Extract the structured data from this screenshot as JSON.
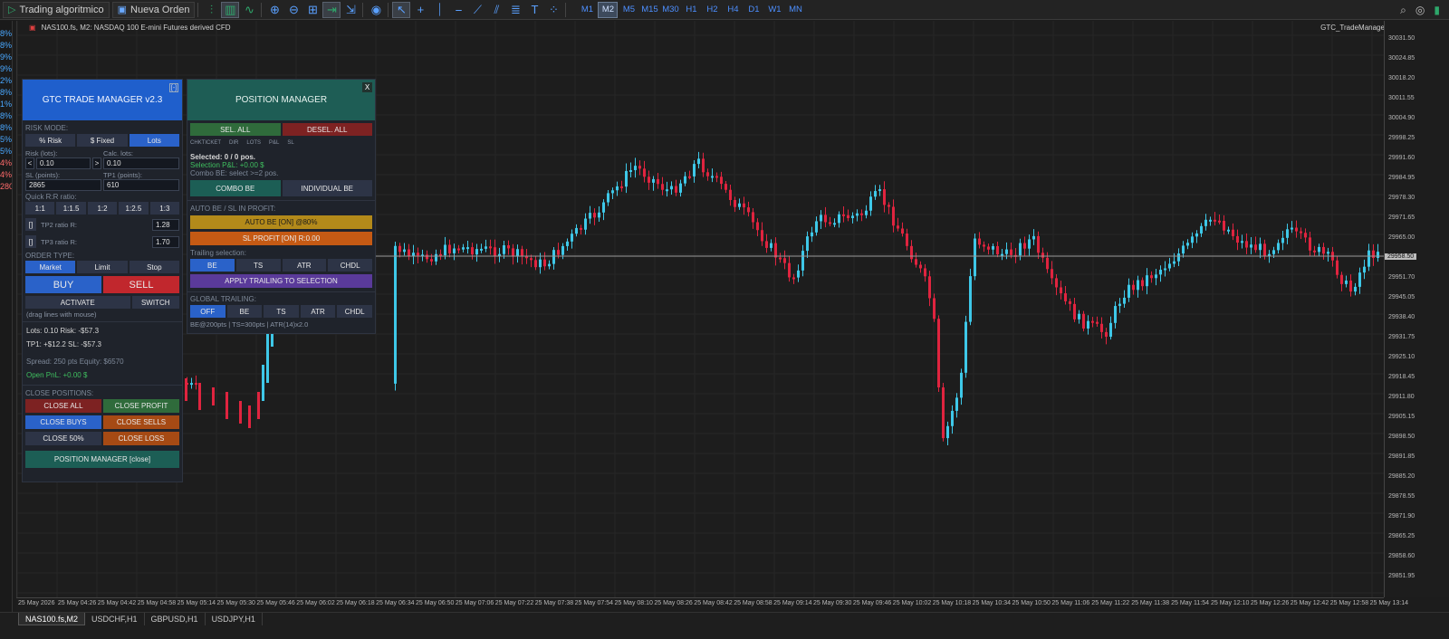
{
  "toolbar": {
    "algo_label": "Trading algoritmico",
    "new_order_label": "Nueva Orden",
    "timeframes": [
      "M1",
      "M2",
      "M5",
      "M15",
      "M30",
      "H1",
      "H2",
      "H4",
      "D1",
      "W1",
      "MN"
    ],
    "active_timeframe": "M2"
  },
  "left_strip": [
    "8%",
    "8%",
    "9%",
    "9%",
    "2%",
    "8%",
    "1%",
    "8%",
    "8%",
    "5%",
    "5%",
    "4%",
    "4%",
    "280"
  ],
  "chart": {
    "title": "NAS100.fs, M2:  NASDAQ 100 E-mini Futures derived CFD",
    "ea_name": "GTC_TradeManager",
    "current_price": "29958.50",
    "price_labels": [
      "30031.50",
      "30024.85",
      "30018.20",
      "30011.55",
      "30004.90",
      "29998.25",
      "29991.60",
      "29984.95",
      "29978.30",
      "29971.65",
      "29965.00",
      "29958.35",
      "29951.70",
      "29945.05",
      "29938.40",
      "29931.75",
      "29925.10",
      "29918.45",
      "29911.80",
      "29905.15",
      "29898.50",
      "29891.85",
      "29885.20",
      "29878.55",
      "29871.90",
      "29865.25",
      "29858.60",
      "29851.95"
    ],
    "time_labels": [
      "25 May 2026",
      "25 May 04:26",
      "25 May 04:42",
      "25 May 04:58",
      "25 May 05:14",
      "25 May 05:30",
      "25 May 05:46",
      "25 May 06:02",
      "25 May 06:18",
      "25 May 06:34",
      "25 May 06:50",
      "25 May 07:06",
      "25 May 07:22",
      "25 May 07:38",
      "25 May 07:54",
      "25 May 08:10",
      "25 May 08:26",
      "25 May 08:42",
      "25 May 08:58",
      "25 May 09:14",
      "25 May 09:30",
      "25 May 09:46",
      "25 May 10:02",
      "25 May 10:18",
      "25 May 10:34",
      "25 May 10:50",
      "25 May 11:06",
      "25 May 11:22",
      "25 May 11:38",
      "25 May 11:54",
      "25 May 12:10",
      "25 May 12:26",
      "25 May 12:42",
      "25 May 12:58",
      "25 May 13:14"
    ],
    "colors": {
      "bull": "#3ec8e8",
      "bear": "#e0243f",
      "bg": "#1d1d1d",
      "grid": "#2a2a2a"
    }
  },
  "tabs": [
    "NAS100.fs,M2",
    "USDCHF,H1",
    "GBPUSD,H1",
    "USDJPY,H1"
  ],
  "trade_manager": {
    "title": "GTC TRADE MANAGER v2.3",
    "min": "[-]",
    "risk_mode": "RISK MODE:",
    "risk_opts": [
      "% Risk",
      "$ Fixed",
      "Lots"
    ],
    "risk_lots_label": "Risk (lots):",
    "calc_lots_label": "Calc. lots:",
    "risk_lots": "0.10",
    "calc_lots": "0.10",
    "sl_label": "SL (points):",
    "tp1_label": "TP1 (points):",
    "sl": "2865",
    "tp1": "610",
    "quick_rr": "Quick R:R ratio:",
    "rr": [
      "1:1",
      "1:1.5",
      "1:2",
      "1:2.5",
      "1:3"
    ],
    "tp2_label": "TP2 ratio R:",
    "tp2": "1.28",
    "tp3_label": "TP3 ratio R:",
    "tp3": "1.70",
    "chk": "[]",
    "order_type": "ORDER TYPE:",
    "order_opts": [
      "Market",
      "Limit",
      "Stop"
    ],
    "buy": "BUY",
    "sell": "SELL",
    "activate": "ACTIVATE",
    "switch": "SWITCH",
    "drag_hint": "(drag lines with mouse)",
    "lots_line": "Lots: 0.10    Risk: -$57.3",
    "tp_line": "TP1: +$12.2    SL: -$57.3",
    "spread_line": "Spread: 250 pts    Equity: $6570",
    "pnl_line": "Open PnL: +0.00 $",
    "close_positions": "CLOSE POSITIONS:",
    "close_all": "CLOSE ALL",
    "close_profit": "CLOSE PROFIT",
    "close_buys": "CLOSE BUYS",
    "close_sells": "CLOSE SELLS",
    "close_50": "CLOSE 50%",
    "close_loss": "CLOSE LOSS",
    "pm_btn": "POSITION MANAGER  [close]"
  },
  "position_manager": {
    "title": "POSITION MANAGER",
    "x": "X",
    "sel_all": "SEL. ALL",
    "desel_all": "DESEL. ALL",
    "headers": [
      "CHK",
      "TICKET",
      "DIR",
      "LOTS",
      "P&L",
      "SL"
    ],
    "selected": "Selected: 0 / 0 pos.",
    "sel_pnl": "Selection P&L: +0.00 $",
    "combo_hint": "Combo BE: select >=2 pos.",
    "combo_be": "COMBO BE",
    "individual_be": "INDIVIDUAL BE",
    "auto_label": "AUTO BE / SL IN PROFIT:",
    "auto_be": "AUTO BE  [ON]  @80%",
    "sl_profit": "SL PROFIT  [ON]  R:0.00",
    "trailing_sel": "Trailing selection:",
    "trail_opts": [
      "BE",
      "TS",
      "ATR",
      "CHDL"
    ],
    "apply": "APPLY TRAILING TO SELECTION",
    "global_trailing": "GLOBAL TRAILING:",
    "global_opts": [
      "OFF",
      "BE",
      "TS",
      "ATR",
      "CHDL"
    ],
    "footer": "BE@200pts | TS=300pts | ATR(14)x2.0"
  }
}
